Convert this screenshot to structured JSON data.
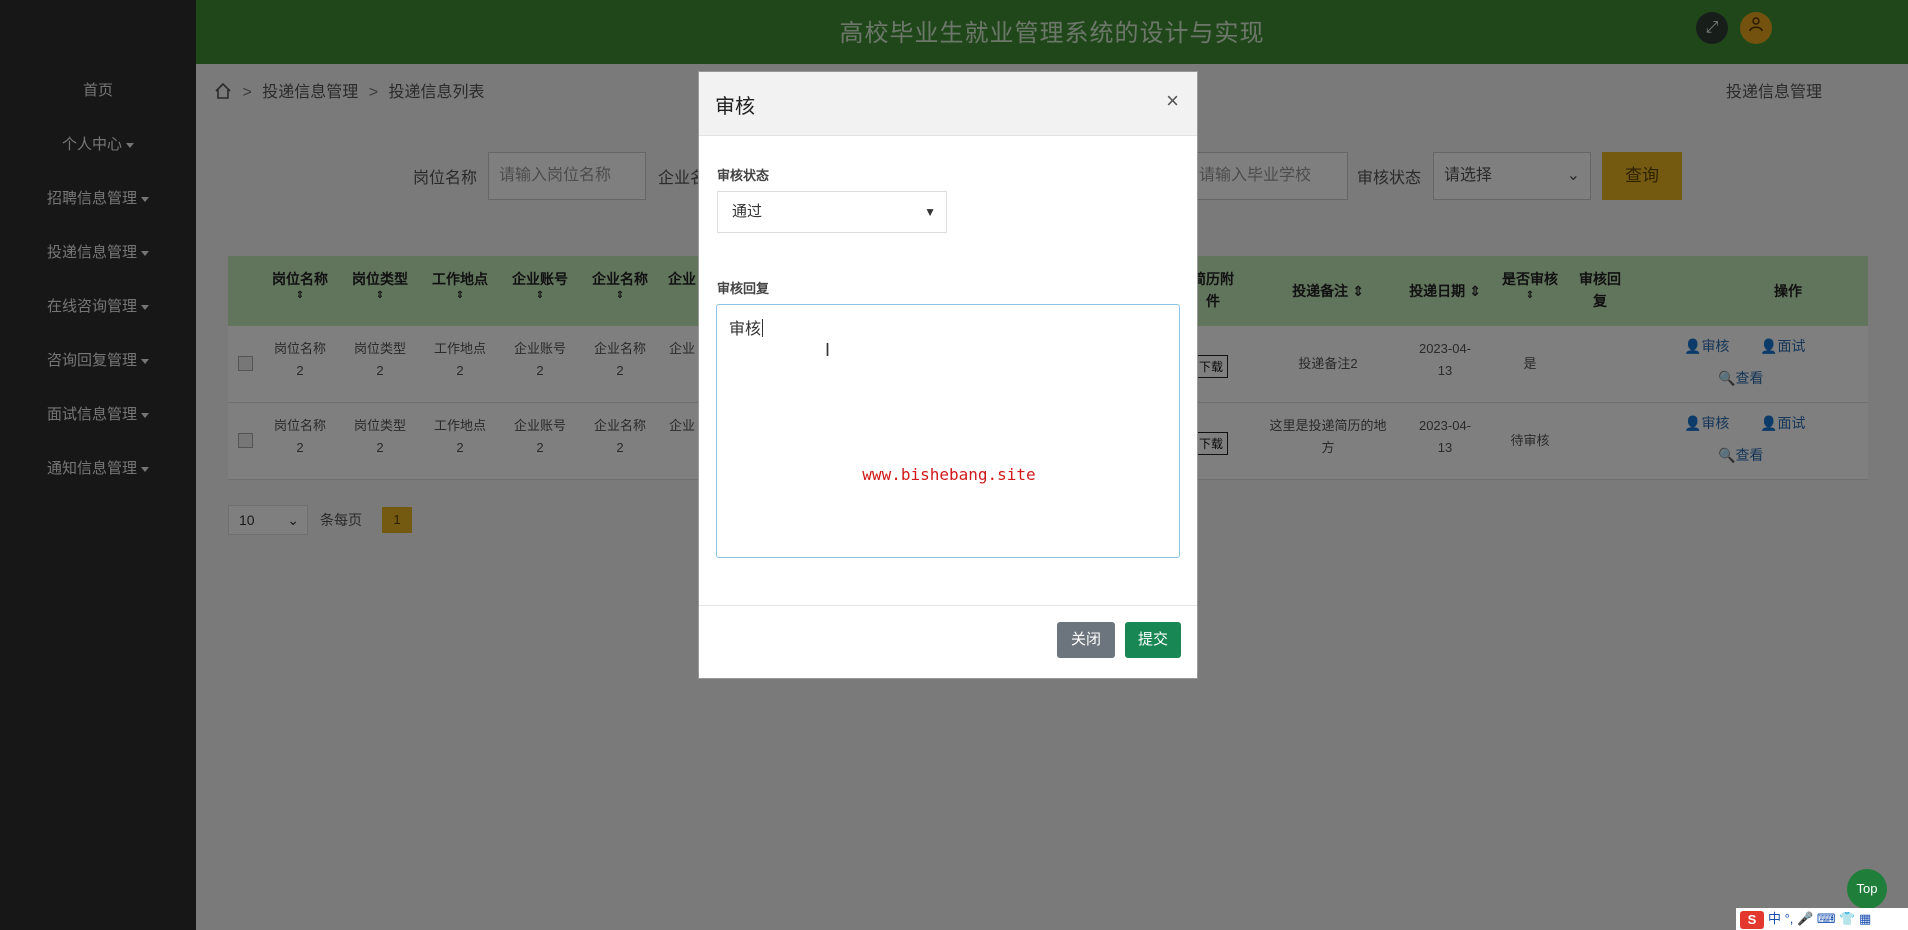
{
  "header": {
    "title": "高校毕业生就业管理系统的设计与实现"
  },
  "sidebar": {
    "items": [
      {
        "label": "首页",
        "has_caret": false
      },
      {
        "label": "个人中心",
        "has_caret": true
      },
      {
        "label": "招聘信息管理",
        "has_caret": true
      },
      {
        "label": "投递信息管理",
        "has_caret": true
      },
      {
        "label": "在线咨询管理",
        "has_caret": true
      },
      {
        "label": "咨询回复管理",
        "has_caret": true
      },
      {
        "label": "面试信息管理",
        "has_caret": true
      },
      {
        "label": "通知信息管理",
        "has_caret": true
      }
    ]
  },
  "breadcrumb": {
    "level1": "投递信息管理",
    "level2": "投递信息列表",
    "sep": ">",
    "right_title": "投递信息管理"
  },
  "search": {
    "job_name_label": "岗位名称",
    "job_name_placeholder": "请输入岗位名称",
    "company_label": "企业名",
    "school_placeholder": "请输入毕业学校",
    "status_label": "审核状态",
    "status_value": "请选择",
    "query_button": "查询"
  },
  "table": {
    "headers": {
      "job_name": "岗位名称",
      "job_type": "岗位类型",
      "work_place": "工作地点",
      "company_account": "企业账号",
      "company_name": "企业名称",
      "company_short": "企业",
      "resume_a": "简历附",
      "resume_b": "件",
      "remark": "投递备注",
      "date": "投递日期",
      "reviewed": "是否审核",
      "reply_a": "审核回",
      "reply_b": "复",
      "ops": "操作"
    },
    "rows": [
      {
        "job_name": "岗位名称",
        "job_type": "岗位类型",
        "work_place": "工作地点",
        "company_account": "企业账号",
        "company_name": "企业名称",
        "company_short": "企业",
        "suffix": "2",
        "download": "下载",
        "remark": "投递备注2",
        "date_a": "2023-04-",
        "date_b": "13",
        "reviewed": "是",
        "act_review": "审核",
        "act_interview": "面试",
        "act_view": "查看"
      },
      {
        "job_name": "岗位名称",
        "job_type": "岗位类型",
        "work_place": "工作地点",
        "company_account": "企业账号",
        "company_name": "企业名称",
        "company_short": "企业",
        "suffix": "2",
        "download": "下载",
        "remark_a": "这里是投递简历的地",
        "remark_b": "方",
        "date_a": "2023-04-",
        "date_b": "13",
        "reviewed": "待审核",
        "act_review": "审核",
        "act_interview": "面试",
        "act_view": "查看"
      }
    ]
  },
  "pager": {
    "page_size": "10",
    "per_page_label": "条每页",
    "current_page": "1"
  },
  "modal": {
    "title": "审核",
    "close_symbol": "×",
    "status_label": "审核状态",
    "status_value": "通过",
    "reply_label": "审核回复",
    "reply_value": "审核",
    "watermark": "www.bishebang.site",
    "close_button": "关闭",
    "submit_button": "提交"
  },
  "top_button": "Top",
  "ime": {
    "logo": "S",
    "text": "中 °, 🎤 ⌨ 👕 ▦"
  },
  "colors": {
    "header": "#3f8f34",
    "sidebar": "#2f2f2f",
    "accent": "#e6b521",
    "submit": "#198754",
    "close_btn": "#6c757d"
  }
}
